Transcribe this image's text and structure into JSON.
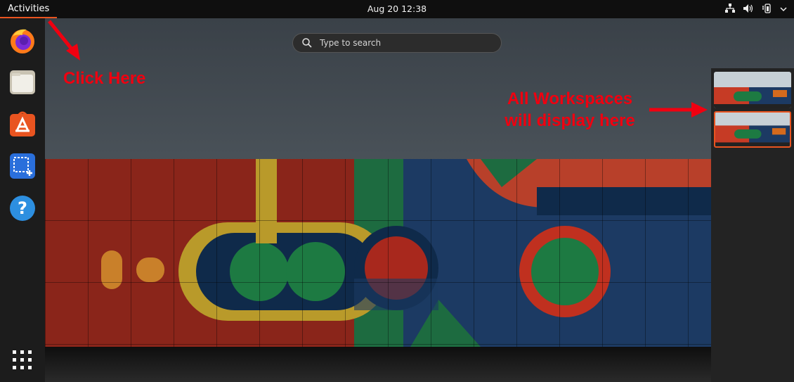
{
  "topbar": {
    "activities_label": "Activities",
    "clock": "Aug 20  12:38",
    "tray_icons": [
      "network-icon",
      "volume-icon",
      "battery-icon",
      "chevron-down-icon"
    ]
  },
  "search": {
    "placeholder": "Type to search"
  },
  "dock": {
    "apps": [
      "firefox-icon",
      "files-icon",
      "software-store-icon",
      "screenshot-icon",
      "help-icon"
    ],
    "show_apps_icon": "app-grid-icon"
  },
  "workspaces": {
    "count": 2,
    "active_index": 1
  },
  "annotations": {
    "click_here": "Click Here",
    "workspaces_line1": "All Workspaces",
    "workspaces_line2": "will display here"
  },
  "colors": {
    "accent": "#e95420",
    "annotation": "#f00010",
    "topbar": "#0f0f0f"
  }
}
